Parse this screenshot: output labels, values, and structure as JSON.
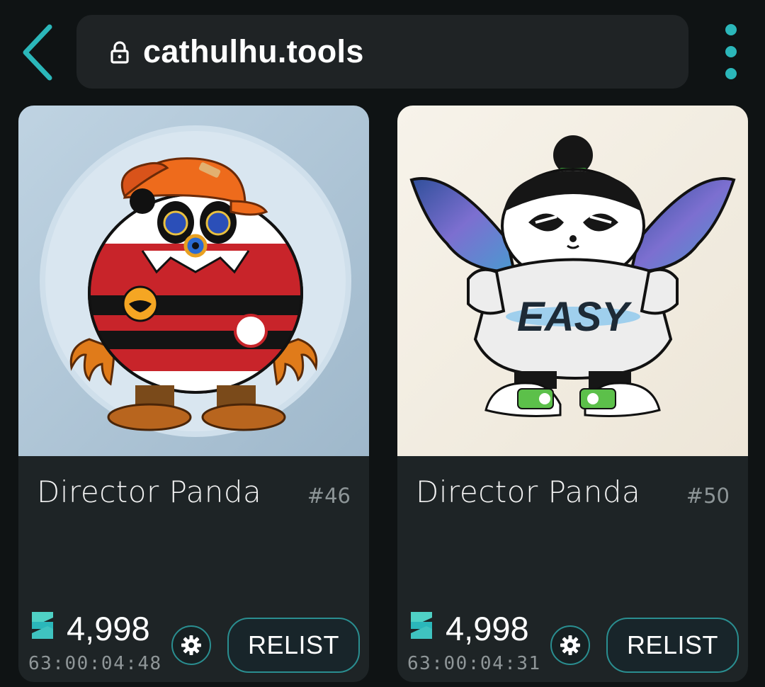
{
  "browser": {
    "url": "cathulhu.tools",
    "back_icon": "chevron-left-icon",
    "lock_icon": "lock-icon",
    "menu_icon": "more-vert-icon",
    "accent_color": "#2bb7ba"
  },
  "cards": [
    {
      "name": "Director Panda",
      "number": "#46",
      "price": "4,998",
      "timer": "63:00:04:48",
      "relist_label": "RELIST",
      "settings_icon": "gear-icon",
      "currency_icon": "zilliqa-icon"
    },
    {
      "name": "Director Panda",
      "number": "#50",
      "price": "4,998",
      "timer": "63:00:04:31",
      "relist_label": "RELIST",
      "settings_icon": "gear-icon",
      "currency_icon": "zilliqa-icon",
      "shirt_text": "EASY"
    }
  ],
  "colors": {
    "background": "#0f1314",
    "card": "#1e2426",
    "button_border": "#2a8e90"
  }
}
